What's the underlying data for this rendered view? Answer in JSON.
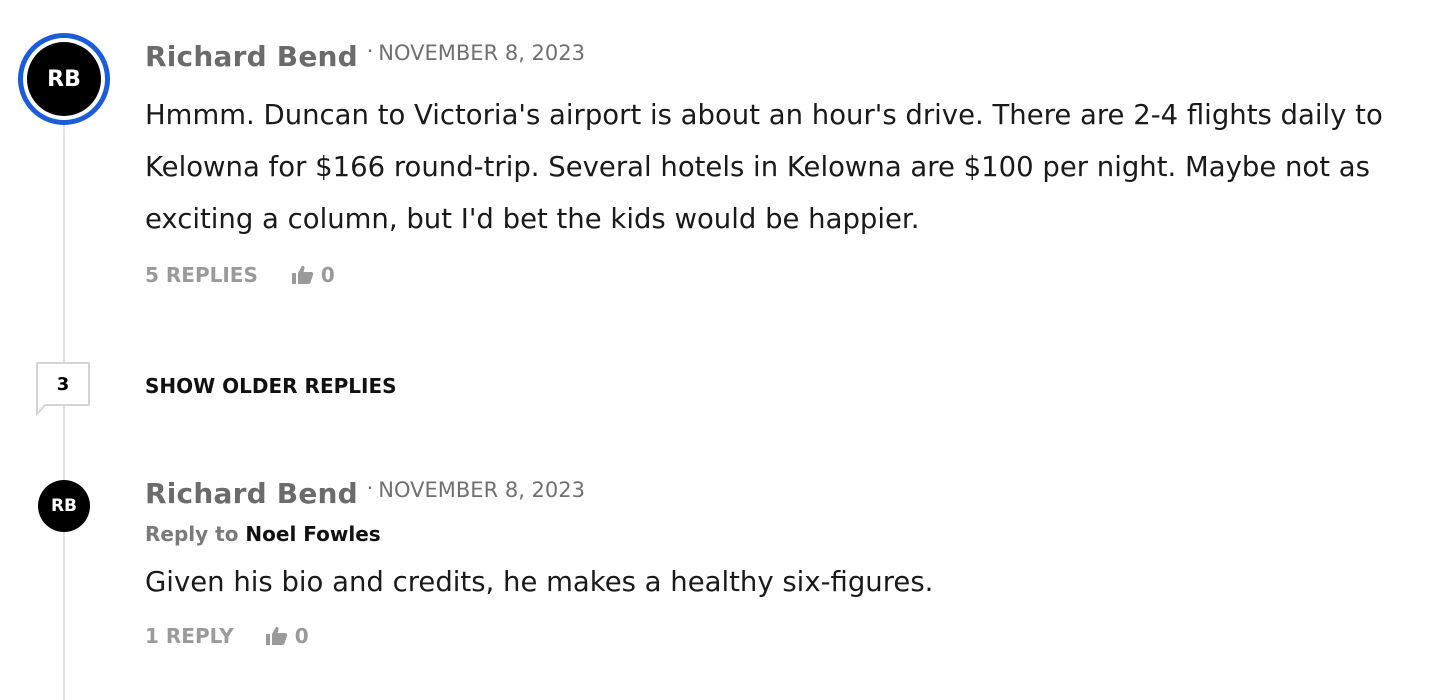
{
  "comments": [
    {
      "avatar_initials": "RB",
      "author": "Richard Bend",
      "separator": "·",
      "date": "NOVEMBER 8, 2023",
      "body": "Hmmm. Duncan to Victoria's airport is about an hour's drive. There are 2-4 flights daily to Kelowna for $166 round-trip. Several hotels in Kelowna are $100 per night. Maybe not as exciting a column, but I'd bet the kids would be happier.",
      "replies_label": "5 REPLIES",
      "likes": "0"
    },
    {
      "avatar_initials": "RB",
      "author": "Richard Bend",
      "separator": "·",
      "date": "NOVEMBER 8, 2023",
      "reply_to_prefix": "Reply to",
      "reply_to_name": "Noel Fowles",
      "body": "Given his bio and credits, he makes a healthy six-figures.",
      "replies_label": "1 REPLY",
      "likes": "0"
    }
  ],
  "older_replies": {
    "count": "3",
    "label": "SHOW OLDER REPLIES"
  },
  "colors": {
    "avatar_ring": "#1c5bd9",
    "avatar_fill": "#000000",
    "author_text": "#6b6b6b",
    "muted_action": "#9a9a9a"
  },
  "icons": {
    "like": "thumbs-up-icon"
  }
}
